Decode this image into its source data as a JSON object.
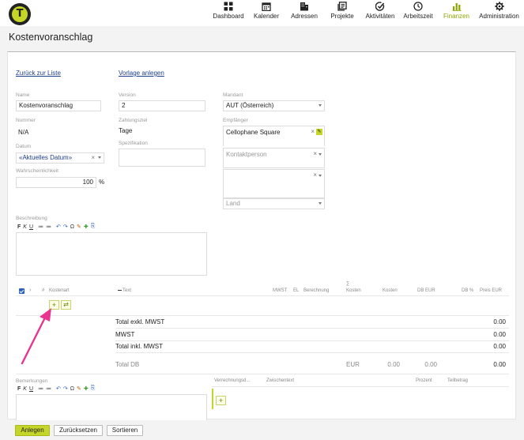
{
  "nav": {
    "items": [
      {
        "label": "Dashboard",
        "icon": "dashboard-icon"
      },
      {
        "label": "Kalender",
        "icon": "calendar-icon"
      },
      {
        "label": "Adressen",
        "icon": "building-icon"
      },
      {
        "label": "Projekte",
        "icon": "projects-icon"
      },
      {
        "label": "Aktivitäten",
        "icon": "activity-icon"
      },
      {
        "label": "Arbeitszeit",
        "icon": "clock-icon"
      },
      {
        "label": "Finanzen",
        "icon": "bar-chart-icon",
        "active": true
      },
      {
        "label": "Administration",
        "icon": "gear-icon"
      }
    ],
    "active_color": "#8ba800",
    "logo_letter": "T"
  },
  "page": {
    "title": "Kostenvoranschlag"
  },
  "links": {
    "back": "Zurück zur Liste",
    "template": "Vorlage anlegen"
  },
  "form": {
    "name": {
      "label": "Name",
      "value": "Kostenvoranschlag"
    },
    "nummer": {
      "label": "Nummer",
      "value": "N/A"
    },
    "datum": {
      "label": "Datum",
      "value": "«Aktuelles Datum»"
    },
    "wahrscheinlichkeit": {
      "label": "Wahrscheinlichkeit",
      "value": "100",
      "unit": "%"
    },
    "version": {
      "label": "Version",
      "value": "2"
    },
    "zahlungsziel": {
      "label": "Zahlungsziel",
      "value": "Tage"
    },
    "spezifikation": {
      "label": "Spezifikation",
      "value": ""
    },
    "mandant": {
      "label": "Mandant",
      "value": "AUT (Österreich)"
    },
    "empfaenger": {
      "label": "Empfänger",
      "value": "Cellophane Square"
    },
    "kontaktperson": {
      "placeholder": "Kontaktperson"
    },
    "land": {
      "placeholder": "Land"
    },
    "beschreibung": {
      "label": "Beschreibung"
    }
  },
  "editor_toolbar": [
    "F",
    "K",
    "U",
    "≔",
    "≔",
    "↶",
    "↷",
    "Ω",
    "✎",
    "✚",
    "⎘"
  ],
  "table": {
    "headers": {
      "nr": "#",
      "kostenart": "Kostenart",
      "text": "Text",
      "mwst": "MWST",
      "el": "EL",
      "berechnung": "Berechnung",
      "sum_symbol": "∑",
      "kosten1": "Kosten",
      "kosten2": "Kosten",
      "db_eur": "DB EUR",
      "db_pct": "DB %",
      "preis_eur": "Preis EUR"
    },
    "add_row": "+",
    "reorder": "⇄"
  },
  "totals": {
    "exkl": {
      "label": "Total exkl. MWST",
      "value": "0.00"
    },
    "mwst": {
      "label": "MWST",
      "value": "0.00"
    },
    "inkl": {
      "label": "Total inkl. MWST",
      "value": "0.00"
    },
    "db": {
      "label": "Total DB",
      "currency": "EUR",
      "kosten": "0.00",
      "db": "0.00",
      "preis": "0.00"
    }
  },
  "remarks": {
    "label": "Bemerkungen",
    "headers": {
      "verrechnung": "Verrechnungsd...",
      "zwischentext": "Zwischentext",
      "prozent": "Prozent",
      "teilbetrag": "Teilbetrag"
    },
    "add": "+"
  },
  "buttons": {
    "anlegen": "Anlegen",
    "zuruecksetzen": "Zurücksetzen",
    "sortieren": "Sortieren"
  },
  "annotation_color": "#e8358f"
}
